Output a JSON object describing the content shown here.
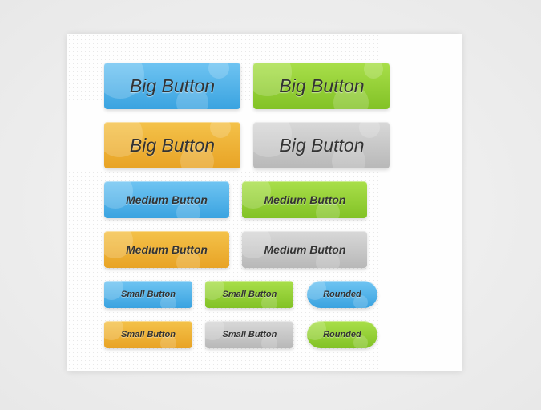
{
  "colors": {
    "blue": "#4cb1e8",
    "green": "#94cf33",
    "orange": "#edb036",
    "gray": "#c7c7c7"
  },
  "big": [
    "Big Button",
    "Big Button",
    "Big Button",
    "Big Button"
  ],
  "med": [
    "Medium Button",
    "Medium Button",
    "Medium Button",
    "Medium Button"
  ],
  "small": [
    "Small Button",
    "Small Button",
    "Rounded",
    "Small Button",
    "Small Button",
    "Rounded"
  ]
}
